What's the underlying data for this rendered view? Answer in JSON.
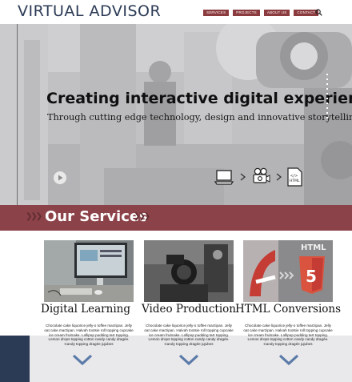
{
  "header": {
    "logo": "VIRTUAL ADVISOR",
    "nav": [
      "SERVICES",
      "PROJECTS",
      "ABOUT US",
      "CONTACT"
    ],
    "search_icon": "search-icon"
  },
  "hero": {
    "title": "Creating interactive digital experiences",
    "subtitle": "Through cutting edge technology, design and innovative storytelling.",
    "play_icon": "play-icon",
    "workflow_icons": [
      "laptop-icon",
      "arrow-right-icon",
      "film-camera-icon",
      "arrow-right-icon",
      "html-file-icon"
    ],
    "html_icon_label": "HTML"
  },
  "services": {
    "heading": "Our Services",
    "items": [
      {
        "title": "Digital Learning",
        "description": "Chocolate cake liquorice jelly-o toffee marzipan. Jelly oat cake marzipan. Halvah tootsie roll topping cupcake ice cream fruitcake. Lollipop pudding tart topping. Lemon drops topping cotton candy candy dragée. Candy topping dragée jujubes"
      },
      {
        "title": "Video Production",
        "description": "Chocolate cake liquorice jelly-o toffee marzipan. Jelly oat cake marzipan. Halvah tootsie roll topping cupcake ice cream fruitcake. Lollipop pudding tart topping. Lemon drops topping cotton candy candy dragée. Candy topping dragée jujubes"
      },
      {
        "title": "HTML Conversions",
        "description": "Chocolate cake liquorice jelly-o toffee marzipan. Jelly oat cake marzipan. Halvah tootsie roll topping cupcake ice cream fruitcake. Lollipop pudding tart topping. Lemon drops topping cotton candy candy dragée. Candy topping dragée jujubes",
        "image_label": "HTML"
      }
    ]
  },
  "colors": {
    "brand_navy": "#2b3a55",
    "accent_maroon": "#8b4248",
    "chevron_blue": "#5b7aa8"
  }
}
